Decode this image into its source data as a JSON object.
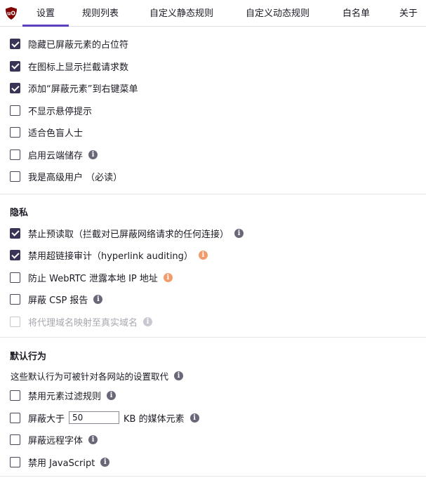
{
  "tabs": [
    {
      "label": "设置"
    },
    {
      "label": "规则列表"
    },
    {
      "label": "自定义静态规则"
    },
    {
      "label": "自定义动态规则"
    },
    {
      "label": "白名单"
    },
    {
      "label": "关于"
    }
  ],
  "logo_text": "uO",
  "general": {
    "items": [
      {
        "label": "隐藏已屏蔽元素的占位符",
        "checked": true
      },
      {
        "label": "在图标上显示拦截请求数",
        "checked": true
      },
      {
        "label": "添加“屏蔽元素”到右键菜单",
        "checked": true
      },
      {
        "label": "不显示悬停提示",
        "checked": false
      },
      {
        "label": "适合色盲人士",
        "checked": false
      },
      {
        "label": "启用云端储存",
        "checked": false
      },
      {
        "label": "我是高级用户 （必读）",
        "checked": false
      }
    ]
  },
  "privacy": {
    "title": "隐私",
    "items": [
      {
        "label": "禁止预读取（拦截对已屏蔽网络请求的任何连接）",
        "checked": true
      },
      {
        "label": "禁用超链接审计（hyperlink auditing）",
        "checked": true
      },
      {
        "label": "防止 WebRTC 泄露本地 IP 地址",
        "checked": false
      },
      {
        "label": "屏蔽 CSP 报告",
        "checked": false
      },
      {
        "label": "将代理域名映射至真实域名",
        "checked": false
      }
    ]
  },
  "defaults": {
    "title": "默认行为",
    "description": "这些默认行为可被针对各网站的设置取代",
    "items": [
      {
        "label": "禁用元素过滤规则",
        "checked": false
      },
      {
        "label_before": "屏蔽大于",
        "value": "50",
        "label_after": "KB 的媒体元素",
        "checked": false
      },
      {
        "label": "屏蔽远程字体",
        "checked": false
      },
      {
        "label": "禁用 JavaScript",
        "checked": false
      }
    ]
  },
  "info_glyph": "i",
  "colors": {
    "accent": "#5a3fc0",
    "checkbox_checked": "#3a3557",
    "info_icon": "#6a6878",
    "info_warning": "#f29c6b"
  }
}
